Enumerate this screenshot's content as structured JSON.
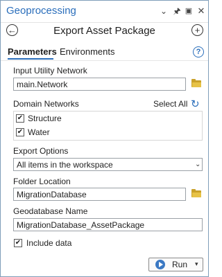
{
  "window": {
    "title": "Geoprocessing"
  },
  "tool": {
    "title": "Export Asset Package"
  },
  "tabs": [
    {
      "label": "Parameters"
    },
    {
      "label": "Environments"
    }
  ],
  "params": {
    "input_network": {
      "label": "Input Utility Network",
      "value": "main.Network"
    },
    "domain_networks": {
      "label": "Domain Networks",
      "select_all": "Select All",
      "items": [
        {
          "label": "Structure",
          "checked": true
        },
        {
          "label": "Water",
          "checked": true
        }
      ]
    },
    "export_options": {
      "label": "Export Options",
      "value": "All items in the workspace"
    },
    "folder_location": {
      "label": "Folder Location",
      "value": "MigrationDatabase"
    },
    "geodatabase_name": {
      "label": "Geodatabase Name",
      "value": "MigrationDatabase_AssetPackage"
    },
    "include_data": {
      "label": "Include data",
      "checked": true
    }
  },
  "run_button": {
    "label": "Run"
  },
  "colors": {
    "accent": "#2a6ebb",
    "folder": "#e7c246"
  }
}
